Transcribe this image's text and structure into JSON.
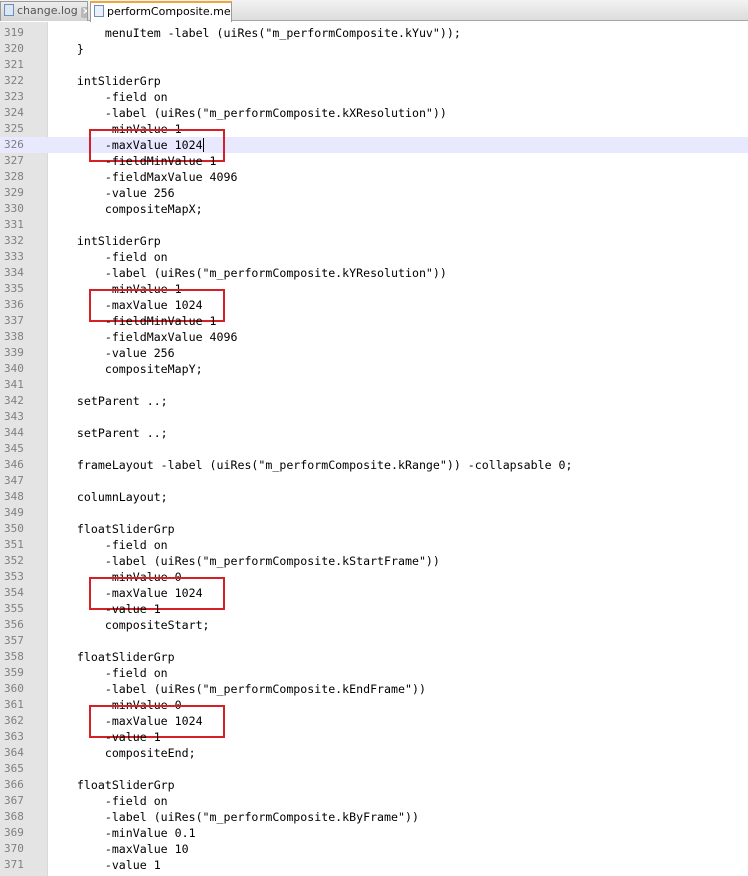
{
  "tabs": [
    {
      "label": "change.log",
      "icon": "file-icon",
      "active": false
    },
    {
      "label": "performComposite.mel",
      "icon": "file-icon",
      "active": true
    }
  ],
  "editor": {
    "first_line": 319,
    "current_line": 326,
    "highlighted_lines": [
      326,
      336,
      354,
      362
    ],
    "lines": [
      "        menuItem -label (uiRes(\"m_performComposite.kYuv\"));",
      "    }",
      "",
      "    intSliderGrp",
      "        -field on",
      "        -label (uiRes(\"m_performComposite.kXResolution\"))",
      "        -minValue 1",
      "        -maxValue 1024",
      "        -fieldMinValue 1",
      "        -fieldMaxValue 4096",
      "        -value 256",
      "        compositeMapX;",
      "",
      "    intSliderGrp",
      "        -field on",
      "        -label (uiRes(\"m_performComposite.kYResolution\"))",
      "        -minValue 1",
      "        -maxValue 1024",
      "        -fieldMinValue 1",
      "        -fieldMaxValue 4096",
      "        -value 256",
      "        compositeMapY;",
      "",
      "    setParent ..;",
      "",
      "    setParent ..;",
      "",
      "    frameLayout -label (uiRes(\"m_performComposite.kRange\")) -collapsable 0;",
      "",
      "    columnLayout;",
      "",
      "    floatSliderGrp",
      "        -field on",
      "        -label (uiRes(\"m_performComposite.kStartFrame\"))",
      "        -minValue 0",
      "        -maxValue 1024",
      "        -value 1",
      "        compositeStart;",
      "",
      "    floatSliderGrp",
      "        -field on",
      "        -label (uiRes(\"m_performComposite.kEndFrame\"))",
      "        -minValue 0",
      "        -maxValue 1024",
      "        -value 1",
      "        compositeEnd;",
      "",
      "    floatSliderGrp",
      "        -field on",
      "        -label (uiRes(\"m_performComposite.kByFrame\"))",
      "        -minValue 0.1",
      "        -maxValue 10",
      "        -value 1"
    ]
  },
  "colors": {
    "highlight_box": "#d42027",
    "current_line_bg": "#e8e8ff",
    "gutter_bg": "#e4e4e4",
    "line_number": "#808080",
    "active_tab_accent": "#f0a640"
  }
}
